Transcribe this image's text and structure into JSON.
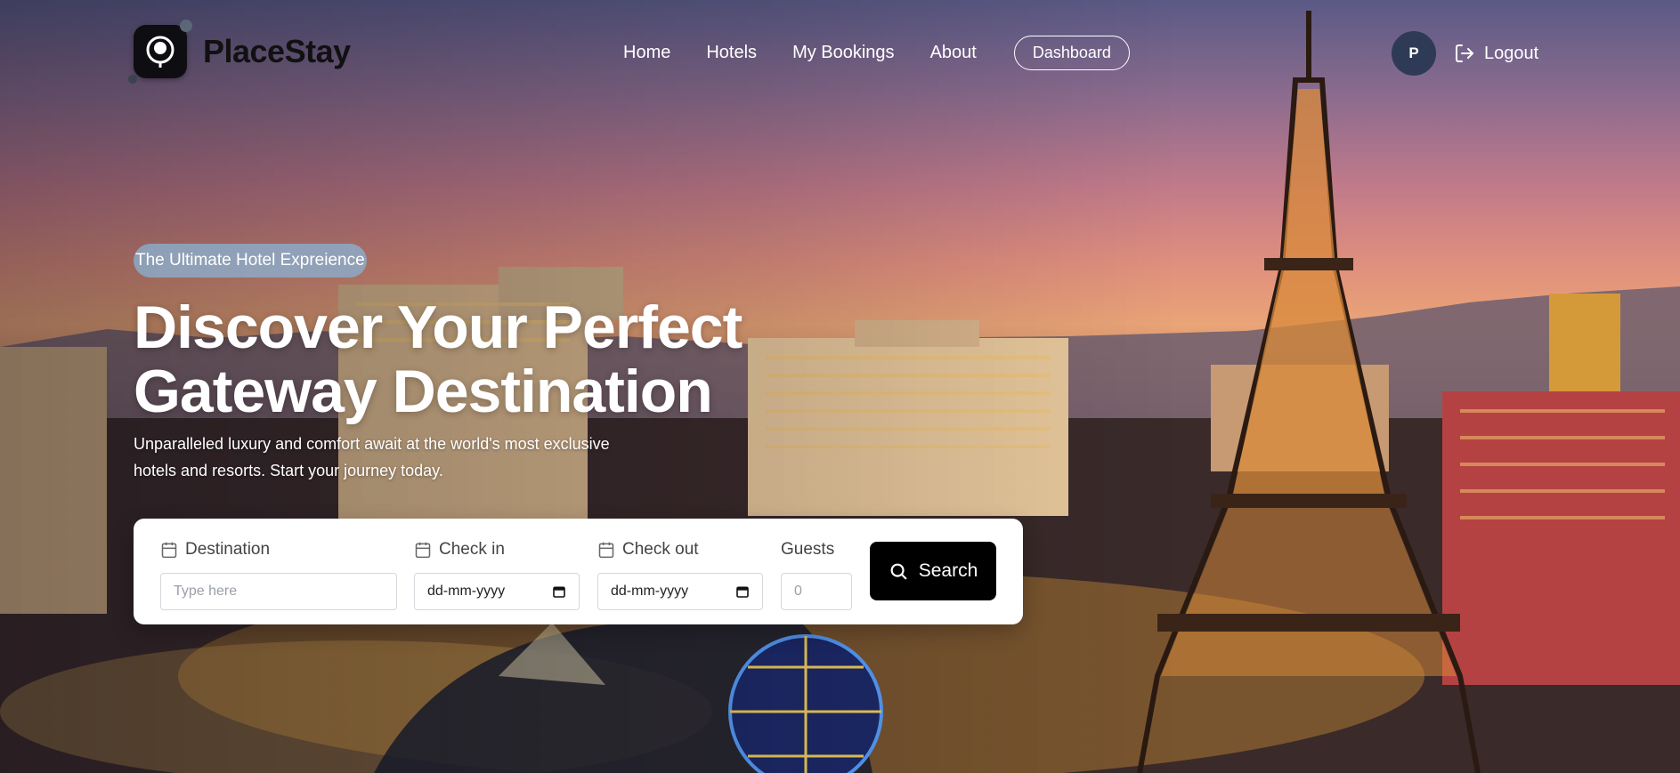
{
  "brand": {
    "name": "PlaceStay"
  },
  "nav": {
    "links": [
      "Home",
      "Hotels",
      "My Bookings",
      "About"
    ],
    "dashboard_label": "Dashboard"
  },
  "user": {
    "avatar_initial": "P",
    "logout_label": "Logout"
  },
  "hero": {
    "badge": "The Ultimate Hotel Expreience",
    "headline_line1": "Discover Your Perfect",
    "headline_line2": "Gateway Destination",
    "subtext_line1": "Unparalleled luxury and comfort await at the world's most exclusive",
    "subtext_line2": "hotels and resorts. Start your journey today."
  },
  "search": {
    "destination": {
      "label": "Destination",
      "placeholder": "Type here"
    },
    "check_in": {
      "label": "Check in",
      "value": "dd-mm-yyyy"
    },
    "check_out": {
      "label": "Check out",
      "value": "dd-mm-yyyy"
    },
    "guests": {
      "label": "Guests",
      "placeholder": "0"
    },
    "button_label": "Search"
  },
  "colors": {
    "accent": "#000000",
    "badge_bg": "#8caac8",
    "avatar_bg": "#2f3b56"
  }
}
